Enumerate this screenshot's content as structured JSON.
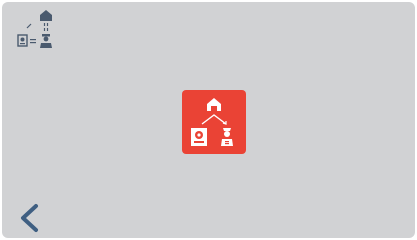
{
  "screen": {
    "background": "#d1d2d4"
  },
  "status_diagram": {
    "icons": [
      "house-icon",
      "door-station-icon",
      "guard-icon"
    ],
    "color": "#4a5a6e"
  },
  "call_guard_tile": {
    "background": "#ea4335",
    "icons": [
      "house-icon",
      "door-station-icon",
      "guard-icon"
    ]
  },
  "navigation": {
    "back_icon": "chevron-left-icon",
    "color": "#3f5f82"
  }
}
